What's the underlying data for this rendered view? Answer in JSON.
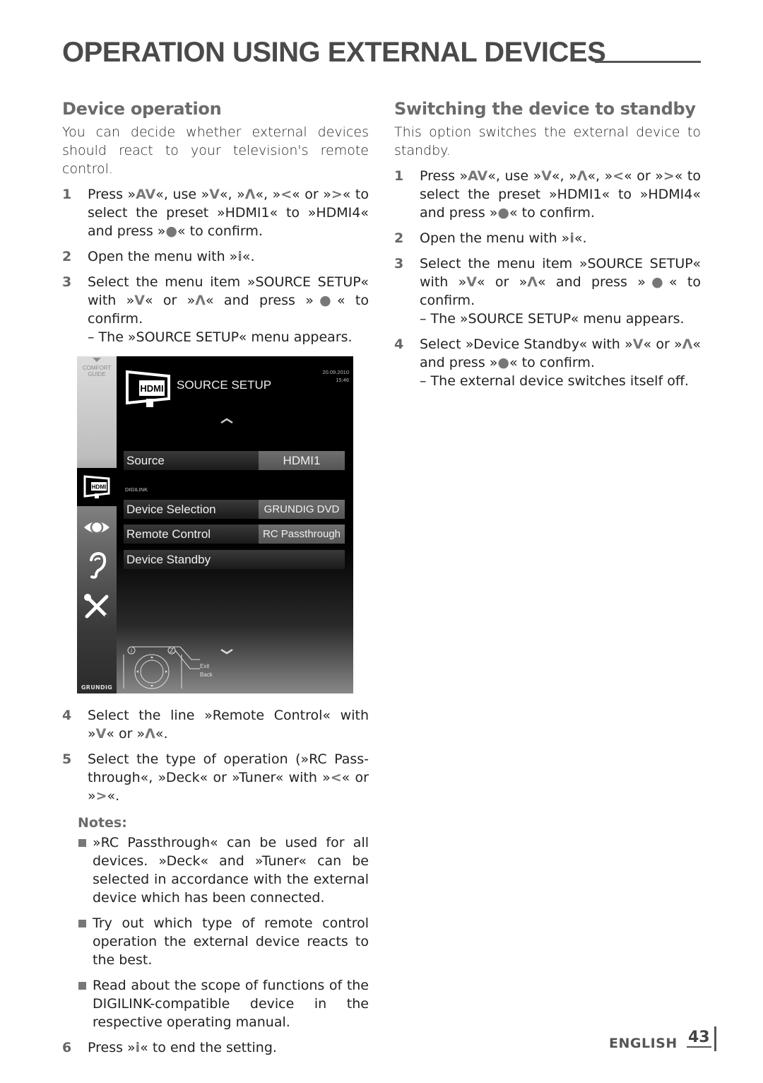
{
  "page": {
    "title": "OPERATION USING EXTERNAL DEVICES",
    "language": "ENGLISH",
    "page_number": "43"
  },
  "left": {
    "heading": "Device operation",
    "intro": "You can decide whether external devices should react to your television's remote control.",
    "steps_before": [
      {
        "num": "1",
        "parts": [
          "Press »",
          "AV",
          "«, use »",
          "V",
          "«, »",
          "Λ",
          "«, »",
          "<",
          "« or »",
          ">",
          "« to select the preset »HDMI1« to »HDMI4« and press »",
          "●",
          "« to confirm."
        ]
      },
      {
        "num": "2",
        "parts": [
          "Open the menu with »",
          "i",
          "«."
        ]
      },
      {
        "num": "3",
        "parts": [
          "Select the menu item »SOURCE SETUP« with »",
          "V",
          "« or »",
          "Λ",
          "« and press »",
          "●",
          "« to confirm."
        ],
        "sub": "– The »SOURCE SETUP« menu appears."
      }
    ],
    "steps_after": [
      {
        "num": "4",
        "parts": [
          "Select the line »Remote Control« with »",
          "V",
          "« or »",
          "Λ",
          "«."
        ]
      },
      {
        "num": "5",
        "parts": [
          "Select the type of operation (»RC Pass-through«, »Deck« or »Tuner« with »",
          "<",
          "« or »",
          ">",
          "«."
        ]
      }
    ],
    "notes_title": "Notes:",
    "notes": [
      "»RC Passthrough« can be used for all devices. »Deck« and »Tuner« can be selected in accordance with the external device which has been connected.",
      "Try out which type of remote control operation the external device reacts to the best.",
      "Read about the scope of functions of the DIGILINK-compatible device in the respective operating manual."
    ],
    "final_step": {
      "num": "6",
      "parts": [
        "Press »",
        "i",
        "« to end the setting."
      ]
    }
  },
  "tv_screen": {
    "comfort_guide": [
      "COMFORT",
      "GUIDE"
    ],
    "hdmi_icon_label": "HDMI",
    "title": "SOURCE SETUP",
    "date": "20.09.2010",
    "time": "15:46",
    "source_label": "Source",
    "source_value": "HDMI1",
    "section_label": "DIGILINK",
    "rows": [
      {
        "label": "Device Selection",
        "value": "GRUNDIG DVD"
      },
      {
        "label": "Remote Control",
        "value": "RC Passthrough"
      },
      {
        "label": "Device Standby",
        "value": ""
      }
    ],
    "legend_exit": "Exit",
    "legend_back": "Back",
    "legend_key_exit": "i",
    "legend_key_back": "Z",
    "brand": "GRUNDIG",
    "side_icons": [
      "hdmi-icon",
      "eye-icon",
      "ear-icon",
      "tools-icon"
    ]
  },
  "right": {
    "heading": "Switching the device to standby",
    "intro": "This option switches the external device to standby.",
    "steps": [
      {
        "num": "1",
        "parts": [
          "Press »",
          "AV",
          "«, use »",
          "V",
          "«, »",
          "Λ",
          "«, »",
          "<",
          "« or »",
          ">",
          "« to select the preset »HDMI1« to »HDMI4« and press »",
          "●",
          "« to confirm."
        ]
      },
      {
        "num": "2",
        "parts": [
          "Open the menu with »",
          "i",
          "«."
        ]
      },
      {
        "num": "3",
        "parts": [
          "Select the menu item »SOURCE SETUP« with »",
          "V",
          "« or »",
          "Λ",
          "« and press »",
          "●",
          "« to confirm."
        ],
        "sub": "– The »SOURCE SETUP« menu appears."
      },
      {
        "num": "4",
        "parts": [
          "Select »Device Standby« with »",
          "V",
          "« or »",
          "Λ",
          "« and press »",
          "●",
          "« to confirm."
        ],
        "sub": "– The external device switches itself off."
      }
    ]
  }
}
